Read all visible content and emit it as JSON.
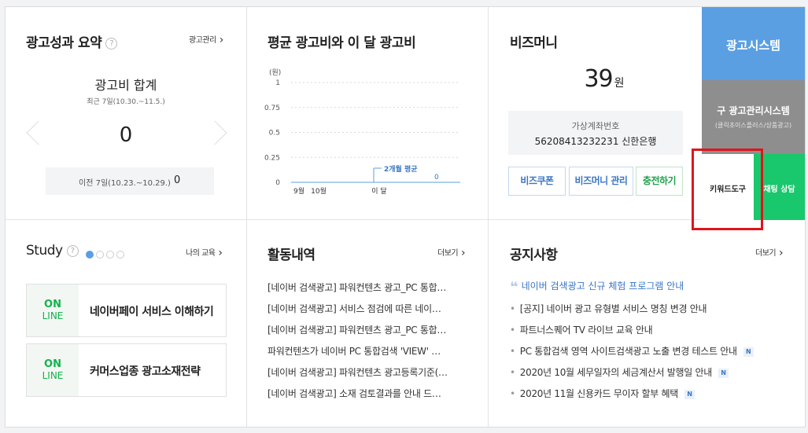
{
  "summary": {
    "title": "광고성과 요약",
    "help_icon": "?",
    "manage_link": "광고관리",
    "cost_title": "광고비 합계",
    "period": "최근 7일(10.30.~11.5.)",
    "cost_value": "0",
    "prev_label": "이전 7일(10.23.~10.29.)",
    "prev_value": "0"
  },
  "avg_chart": {
    "title": "평균 광고비와 이 달 광고비",
    "unit_label": "(원)",
    "annotation": "2개월 평균",
    "annotation_value": "0"
  },
  "chart_data": {
    "type": "line",
    "title": "평균 광고비와 이 달 광고비",
    "ylabel": "(원)",
    "categories": [
      "9월",
      "10월",
      "이 달"
    ],
    "series": [
      {
        "name": "2개월 평균",
        "values": [
          0,
          0,
          0
        ]
      }
    ],
    "yticks": [
      "1",
      "0.75",
      "0.5",
      "0.25",
      "0"
    ],
    "ylim": [
      0,
      1
    ],
    "grid": true
  },
  "bizmoney": {
    "title": "비즈머니",
    "amount": "39",
    "unit": "원",
    "account_label": "가상계좌번호",
    "account_value": "56208413232231 신한은행",
    "btn_coupon": "비즈쿠폰",
    "btn_manage": "비즈머니 관리",
    "btn_charge": "충전하기"
  },
  "side": {
    "ad_system": "광고시스템",
    "old_system": "구 광고관리시스템",
    "old_system_sub": "(클릭초이스플러스/상품광고)",
    "keyword_tool": "키워드도구",
    "chat": "채팅 상담"
  },
  "study": {
    "title": "Study",
    "help_icon": "?",
    "my_edu": "나의 교육",
    "online_1": "ON",
    "online_2": "LINE",
    "cards": [
      {
        "label": "네이버페이 서비스 이해하기"
      },
      {
        "label": "커머스업종 광고소재전략"
      }
    ]
  },
  "activity": {
    "title": "활동내역",
    "more": "더보기",
    "items": [
      "[네이버 검색광고] 파워컨텐츠 광고_PC 통합…",
      "[네이버 검색광고] 서비스 점검에 따른 네이…",
      "[네이버 검색광고] 파워컨텐츠 광고_PC 통합…",
      "파워컨텐츠가 네이버 PC 통합검색 'VIEW' …",
      "[네이버 검색광고] 파워컨텐츠 광고등록기준(…",
      "[네이버 검색광고] 소재 검토결과를 안내 드…"
    ]
  },
  "notice": {
    "title": "공지사항",
    "more": "더보기",
    "featured": "네이버 검색광고 신규 체험 프로그램 안내",
    "items": [
      {
        "text": "[공지] 네이버 광고 유형별 서비스 명칭 변경 안내",
        "new": ""
      },
      {
        "text": "파트너스퀘어 TV 라이브 교육 안내",
        "new": ""
      },
      {
        "text": "PC 통합검색 영역 사이트검색광고 노출 변경 테스트 안내",
        "new": "N"
      },
      {
        "text": "2020년 10월 세무일자의 세금계산서 발행일 안내",
        "new": "N"
      },
      {
        "text": "2020년 11월 신용카드 무이자 할부 혜택",
        "new": "N"
      }
    ]
  },
  "colors": {
    "ad_system": "#5b9fe3",
    "old_system": "#8e8e8e",
    "chat": "#19c76c",
    "highlight": "#e0141b",
    "online": "#12b34a",
    "link": "#3a76c4"
  }
}
